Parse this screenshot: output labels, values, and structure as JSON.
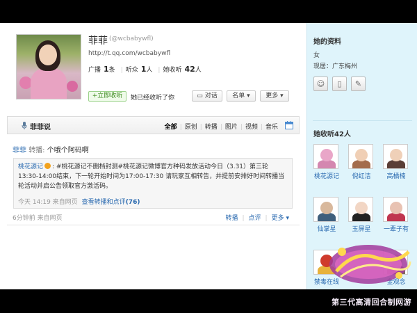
{
  "profile": {
    "name": "菲菲",
    "handle": "(@wcbabywfl)",
    "url": "http://t.qq.com/wcbabywfl",
    "stats": [
      {
        "prefix": "广播",
        "value": "1",
        "suffix": "条"
      },
      {
        "prefix": "听众",
        "value": "1",
        "suffix": "人"
      },
      {
        "prefix": "她收听",
        "value": "42",
        "suffix": "人"
      }
    ],
    "listen_button": "+立即收听",
    "listen_note": "她已经收听了你",
    "talk_button": "对话",
    "list_button": "名单",
    "more_button": "更多"
  },
  "feed": {
    "title": "菲菲说",
    "filters": [
      "全部",
      "原创",
      "转播",
      "图片",
      "视频",
      "音乐"
    ],
    "post": {
      "author": "菲菲",
      "verb": "转播:",
      "text": "个哦个阿码啊",
      "quote_author": "桃花源记",
      "quote_text": ": #桃花源记不删档封测#桃花源记微博官方种码发放活动今日（3.31）第三轮13:30-14:00结束，下一轮开始时间为17:00-17:30 请玩家互相转告，并提前安排好时间转播当轮活动并启公告领取官方激活码。",
      "quote_time": "今天 14:19 来自网页",
      "quote_link": "查看转播和点评",
      "quote_count": "(76)",
      "time": "6分钟前 来自网页",
      "actions": [
        "转播",
        "点评",
        "更多"
      ]
    }
  },
  "sidebar": {
    "info_title": "她的资料",
    "gender": "女",
    "location": "现居：广东梅州",
    "following_title": "她收听42人",
    "following": [
      {
        "name": "桃花源记",
        "color": "#e9a6c8",
        "body": "#d487b0"
      },
      {
        "name": "倪虹洁",
        "color": "#f0cfb5",
        "body": "#a36c4c"
      },
      {
        "name": "高橘楠",
        "color": "#efd0b8",
        "body": "#5a3e36"
      },
      {
        "name": "仙掌星",
        "color": "#d8b89c",
        "body": "#3f5f7c"
      },
      {
        "name": "玉屏星",
        "color": "#f2d6c4",
        "body": "#222"
      },
      {
        "name": "一辈子有",
        "color": "#e8c2b2",
        "body": "#c0354f"
      },
      {
        "name": "禁毒在线",
        "color": "#cf3a2c",
        "body": "#e7b23b"
      },
      {
        "name": "金观念",
        "color": "#e5c9b5",
        "body": "#806a5a"
      }
    ]
  },
  "footer": {
    "text": "第三代高清回合制网游"
  },
  "colors": {
    "accent": "#2a6ab0",
    "sidebar_bg": "#dff4fb"
  }
}
